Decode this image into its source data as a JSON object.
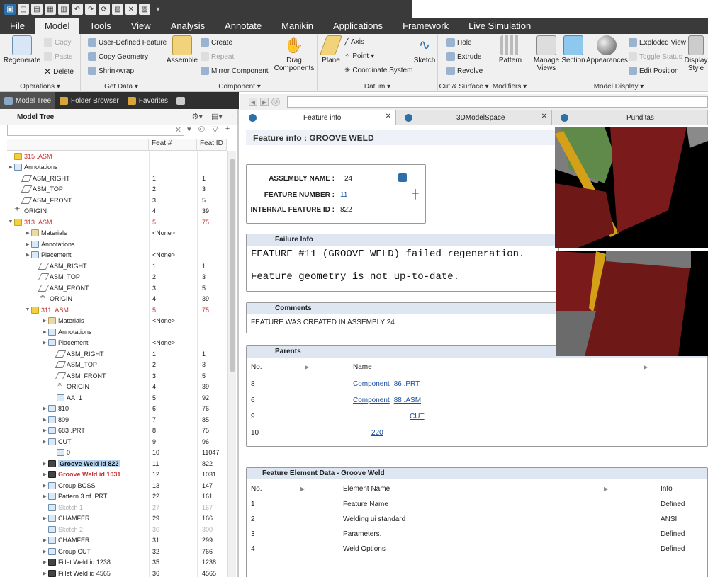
{
  "quick_access": {
    "icons": [
      "app-icon",
      "new-icon",
      "open-icon",
      "save-icon",
      "print-icon",
      "undo-icon",
      "redo-icon",
      "regenerate-icon",
      "windows-icon",
      "close-window-icon",
      "display-icon",
      "customize-icon"
    ]
  },
  "menubar": {
    "tabs": [
      "File",
      "Model",
      "Tools",
      "View",
      "Analysis",
      "Annotate",
      "Manikin",
      "Applications",
      "Framework",
      "Live Simulation"
    ],
    "active": "Model"
  },
  "ribbon": {
    "operations": {
      "label": "Operations ▾",
      "regenerate": "Regenerate",
      "copy": "Copy",
      "paste": "Paste",
      "delete": "Delete"
    },
    "getdata": {
      "label": "Get Data ▾",
      "udf": "User-Defined Feature",
      "copy_geometry": "Copy Geometry",
      "shrinkwrap": "Shrinkwrap"
    },
    "component": {
      "label": "Component ▾",
      "assemble": "Assemble",
      "create": "Create",
      "repeat": "Repeat",
      "mirror": "Mirror Component",
      "drag_l1": "Drag",
      "drag_l2": "Components"
    },
    "datum": {
      "label": "Datum ▾",
      "plane": "Plane",
      "axis": "Axis",
      "point": "Point",
      "csys": "Coordinate System",
      "sketch": "Sketch"
    },
    "cutsurface": {
      "label": "Cut & Surface ▾",
      "hole": "Hole",
      "extrude": "Extrude",
      "revolve": "Revolve"
    },
    "modifiers": {
      "label": "Modifiers ▾",
      "pattern": "Pattern"
    },
    "display": {
      "label": "Model Display ▾",
      "manage_l1": "Manage",
      "manage_l2": "Views",
      "section": "Section",
      "appearances": "Appearances",
      "exploded": "Exploded View",
      "toggle": "Toggle Status",
      "edit_position": "Edit Position",
      "display_l1": "Display",
      "display_l2": "Style"
    }
  },
  "panel_tabs": [
    "Model Tree",
    "Folder Browser",
    "Favorites"
  ],
  "model_tree": {
    "title": "Model Tree",
    "columns": [
      "",
      "Feat #",
      "Feat ID"
    ],
    "rows": [
      {
        "t": "315          .ASM",
        "f": "",
        "id": "",
        "d": 0,
        "tw": "",
        "ic": "warn",
        "cls": "red"
      },
      {
        "t": "Annotations",
        "f": "",
        "id": "",
        "d": 0,
        "tw": "▶",
        "ic": "",
        "cls": ""
      },
      {
        "t": "ASM_RIGHT",
        "f": "1",
        "id": "1",
        "d": 1,
        "tw": "",
        "ic": "plane",
        "cls": ""
      },
      {
        "t": "ASM_TOP",
        "f": "2",
        "id": "3",
        "d": 1,
        "tw": "",
        "ic": "plane",
        "cls": ""
      },
      {
        "t": "ASM_FRONT",
        "f": "3",
        "id": "5",
        "d": 1,
        "tw": "",
        "ic": "plane",
        "cls": ""
      },
      {
        "t": "ORIGIN",
        "f": "4",
        "id": "39",
        "d": 0,
        "tw": "",
        "ic": "csys",
        "cls": ""
      },
      {
        "t": "313          .ASM",
        "f": "5",
        "id": "75",
        "d": 0,
        "tw": "▼",
        "ic": "warn",
        "cls": "red"
      },
      {
        "t": "Materials",
        "f": "<None>",
        "id": "",
        "d": 2,
        "tw": "▶",
        "ic": "fold",
        "cls": ""
      },
      {
        "t": "Annotations",
        "f": "",
        "id": "",
        "d": 2,
        "tw": "▶",
        "ic": "",
        "cls": ""
      },
      {
        "t": "Placement",
        "f": "<None>",
        "id": "",
        "d": 2,
        "tw": "▶",
        "ic": "",
        "cls": ""
      },
      {
        "t": "ASM_RIGHT",
        "f": "1",
        "id": "1",
        "d": 3,
        "tw": "",
        "ic": "plane",
        "cls": ""
      },
      {
        "t": "ASM_TOP",
        "f": "2",
        "id": "3",
        "d": 3,
        "tw": "",
        "ic": "plane",
        "cls": ""
      },
      {
        "t": "ASM_FRONT",
        "f": "3",
        "id": "5",
        "d": 3,
        "tw": "",
        "ic": "plane",
        "cls": ""
      },
      {
        "t": "ORIGIN",
        "f": "4",
        "id": "39",
        "d": 3,
        "tw": "",
        "ic": "csys",
        "cls": ""
      },
      {
        "t": "311          .ASM",
        "f": "5",
        "id": "75",
        "d": 2,
        "tw": "▼",
        "ic": "warn",
        "cls": "red"
      },
      {
        "t": "Materials",
        "f": "<None>",
        "id": "",
        "d": 4,
        "tw": "▶",
        "ic": "fold",
        "cls": ""
      },
      {
        "t": "Annotations",
        "f": "",
        "id": "",
        "d": 4,
        "tw": "▶",
        "ic": "",
        "cls": ""
      },
      {
        "t": "Placement",
        "f": "<None>",
        "id": "",
        "d": 4,
        "tw": "▶",
        "ic": "",
        "cls": ""
      },
      {
        "t": "ASM_RIGHT",
        "f": "1",
        "id": "1",
        "d": 5,
        "tw": "",
        "ic": "plane",
        "cls": ""
      },
      {
        "t": "ASM_TOP",
        "f": "2",
        "id": "3",
        "d": 5,
        "tw": "",
        "ic": "plane",
        "cls": ""
      },
      {
        "t": "ASM_FRONT",
        "f": "3",
        "id": "5",
        "d": 5,
        "tw": "",
        "ic": "plane",
        "cls": ""
      },
      {
        "t": "ORIGIN",
        "f": "4",
        "id": "39",
        "d": 5,
        "tw": "",
        "ic": "csys",
        "cls": ""
      },
      {
        "t": "AA_1",
        "f": "5",
        "id": "92",
        "d": 5,
        "tw": "",
        "ic": "",
        "cls": ""
      },
      {
        "t": "810",
        "f": "6",
        "id": "76",
        "d": 4,
        "tw": "▶",
        "ic": "",
        "cls": ""
      },
      {
        "t": "809",
        "f": "7",
        "id": "85",
        "d": 4,
        "tw": "▶",
        "ic": "",
        "cls": ""
      },
      {
        "t": "683          .PRT",
        "f": "8",
        "id": "75",
        "d": 4,
        "tw": "▶",
        "ic": "",
        "cls": ""
      },
      {
        "t": "CUT",
        "f": "9",
        "id": "96",
        "d": 4,
        "tw": "▶",
        "ic": "",
        "cls": ""
      },
      {
        "t": "0",
        "f": "10",
        "id": "11047",
        "d": 5,
        "tw": "",
        "ic": "",
        "cls": ""
      },
      {
        "t": "Groove Weld id 822",
        "f": "11",
        "id": "822",
        "d": 4,
        "tw": "▶",
        "ic": "weld",
        "cls": "sel"
      },
      {
        "t": "Groove Weld id 1031",
        "f": "12",
        "id": "1031",
        "d": 4,
        "tw": "▶",
        "ic": "weld",
        "cls": "boldred"
      },
      {
        "t": "Group                 BOSS",
        "f": "13",
        "id": "147",
        "d": 4,
        "tw": "▶",
        "ic": "",
        "cls": ""
      },
      {
        "t": "Pattern 3 of                  .PRT",
        "f": "22",
        "id": "161",
        "d": 4,
        "tw": "▶",
        "ic": "",
        "cls": ""
      },
      {
        "t": "Sketch 1",
        "f": "27",
        "id": "167",
        "d": 4,
        "tw": "",
        "ic": "",
        "cls": "gray"
      },
      {
        "t": "CHAMFER",
        "f": "29",
        "id": "166",
        "d": 4,
        "tw": "▶",
        "ic": "",
        "cls": ""
      },
      {
        "t": "Sketch 2",
        "f": "30",
        "id": "300",
        "d": 4,
        "tw": "",
        "ic": "",
        "cls": "gray"
      },
      {
        "t": "CHAMFER",
        "f": "31",
        "id": "299",
        "d": 4,
        "tw": "▶",
        "ic": "",
        "cls": ""
      },
      {
        "t": "Group             CUT",
        "f": "32",
        "id": "766",
        "d": 4,
        "tw": "▶",
        "ic": "",
        "cls": ""
      },
      {
        "t": "Fillet Weld id 1238",
        "f": "35",
        "id": "1238",
        "d": 4,
        "tw": "▶",
        "ic": "weld",
        "cls": ""
      },
      {
        "t": "Fillet Weld id 4565",
        "f": "36",
        "id": "4565",
        "d": 4,
        "tw": "▶",
        "ic": "weld",
        "cls": ""
      }
    ]
  },
  "browser_tabs": [
    "Feature info",
    "3DModelSpace",
    "Punditas"
  ],
  "feature_info": {
    "title": "Feature info : GROOVE WELD",
    "assembly_name_label": "ASSEMBLY NAME :",
    "assembly_name": "24",
    "feature_number_label": "FEATURE NUMBER :",
    "feature_number": "11",
    "internal_id_label": "INTERNAL FEATURE ID :",
    "internal_id": "822",
    "failure_head": "Failure Info",
    "failure_line1": "FEATURE #11 (GROOVE WELD) failed regeneration.",
    "failure_line2": "Feature geometry is not up-to-date.",
    "comments_head": "Comments",
    "comments": "FEATURE WAS CREATED IN ASSEMBLY  24",
    "parents_head": "Parents",
    "parents_cols": [
      "No.",
      "Name"
    ],
    "parents": [
      {
        "no": "8",
        "a": "Component",
        "b": "86                .PRT"
      },
      {
        "no": "6",
        "a": "Component",
        "b": "88                .ASM"
      },
      {
        "no": "9",
        "a": "",
        "b": "CUT"
      },
      {
        "no": "10",
        "a": "",
        "b": "220"
      }
    ],
    "elem_head": "Feature Element Data - Groove Weld",
    "elem_cols": [
      "No.",
      "Element Name",
      "Info"
    ],
    "elements": [
      {
        "no": "1",
        "name": "Feature Name",
        "info": "Defined"
      },
      {
        "no": "2",
        "name": "Welding ui standard",
        "info": "ANSI"
      },
      {
        "no": "3",
        "name": "Parameters.",
        "info": "Defined"
      },
      {
        "no": "4",
        "name": "Weld Options",
        "info": "Defined"
      }
    ]
  },
  "colors": {
    "accent": "#2d6fa8",
    "error": "#c83232",
    "weld_red": "#7a1a1a",
    "weld_orange": "#d4a017",
    "weld_green": "#5f8a4a"
  }
}
